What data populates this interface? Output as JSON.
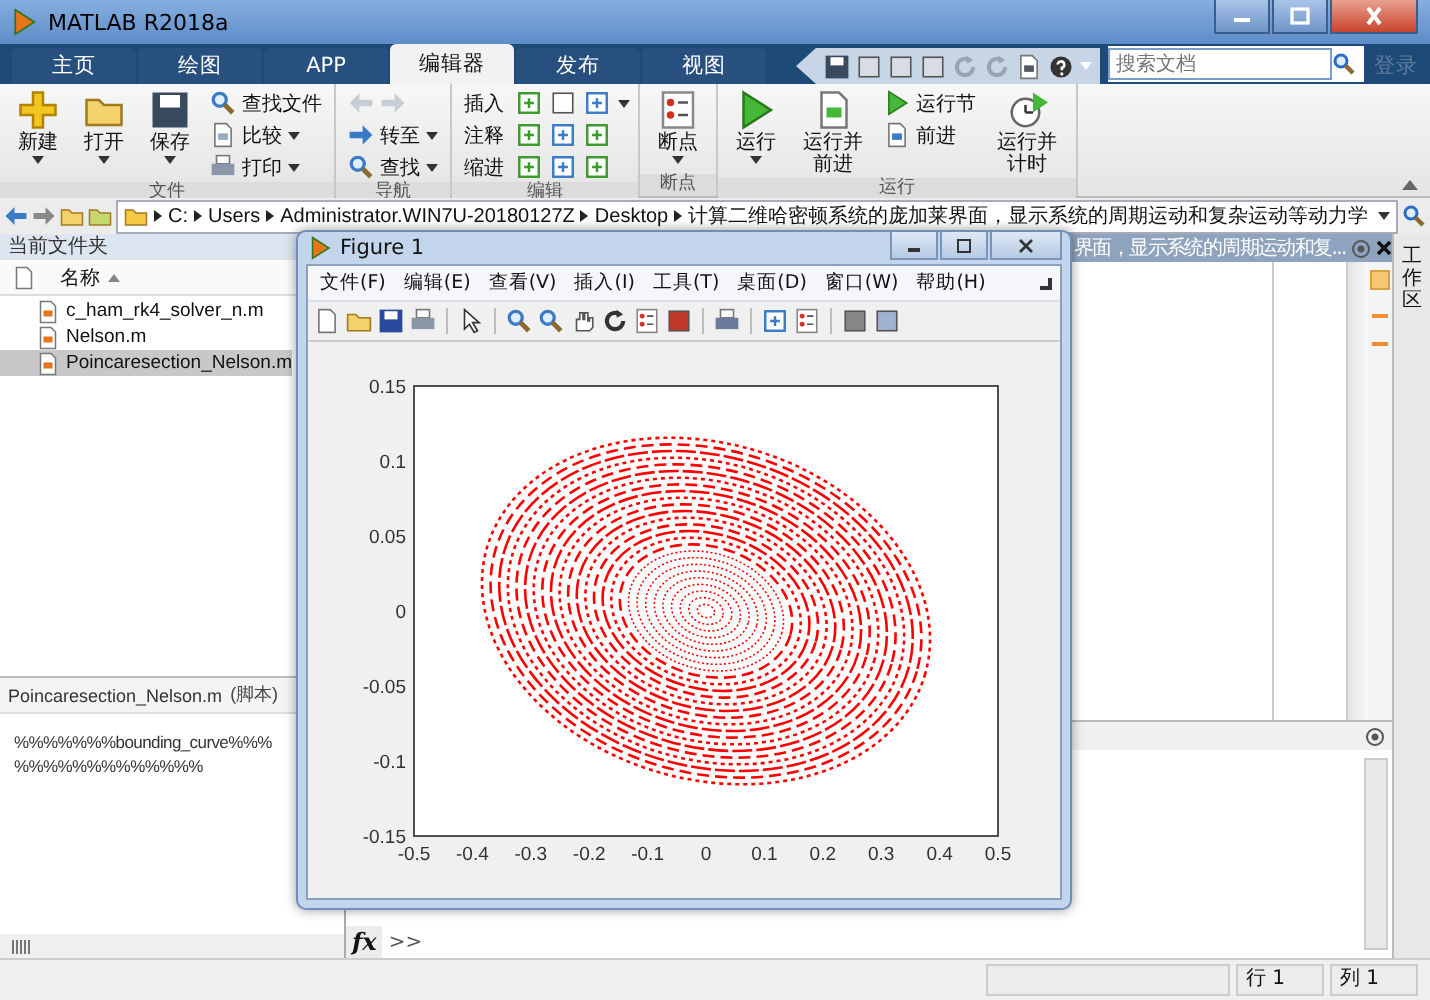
{
  "window": {
    "title": "MATLAB R2018a"
  },
  "tabs": [
    {
      "label": "主页",
      "selected": false
    },
    {
      "label": "绘图",
      "selected": false
    },
    {
      "label": "APP",
      "selected": false
    },
    {
      "label": "编辑器",
      "selected": true
    },
    {
      "label": "发布",
      "selected": false
    },
    {
      "label": "视图",
      "selected": false
    }
  ],
  "search": {
    "placeholder": "搜索文档"
  },
  "sign_in": "登录",
  "ribbon": [
    {
      "title": "文件",
      "columns": [
        [
          {
            "kind": "large",
            "label": "新建",
            "dropdown": true
          }
        ],
        [
          {
            "kind": "large",
            "label": "打开",
            "dropdown": true
          }
        ],
        [
          {
            "kind": "large",
            "label": "保存",
            "dropdown": true
          }
        ],
        [
          {
            "kind": "small",
            "label": "查找文件",
            "dropdown": false
          },
          {
            "kind": "small",
            "label": "比较",
            "dropdown": true
          },
          {
            "kind": "small",
            "label": "打印",
            "dropdown": true
          }
        ]
      ]
    },
    {
      "title": "导航",
      "columns": [
        [
          {
            "kind": "arrows"
          },
          {
            "kind": "small",
            "label": "转至",
            "dropdown": true
          },
          {
            "kind": "small",
            "label": "查找",
            "dropdown": true
          }
        ]
      ]
    },
    {
      "title": "编辑",
      "columns": [
        [
          {
            "kind": "row",
            "label": "插入",
            "dropdown": true
          },
          {
            "kind": "row",
            "label": "注释",
            "dropdown": false
          },
          {
            "kind": "row",
            "label": "缩进",
            "dropdown": false
          }
        ]
      ]
    },
    {
      "title": "断点",
      "columns": [
        [
          {
            "kind": "large",
            "label": "断点",
            "dropdown": true
          }
        ]
      ]
    },
    {
      "title": "运行",
      "columns": [
        [
          {
            "kind": "large",
            "label": "运行",
            "dropdown": true
          }
        ],
        [
          {
            "kind": "large",
            "label": "运行并前进",
            "dropdown": false
          }
        ],
        [
          {
            "kind": "small",
            "label": "运行节",
            "dropdown": false
          },
          {
            "kind": "small",
            "label": "前进",
            "dropdown": false
          }
        ],
        [
          {
            "kind": "large",
            "label": "运行并计时",
            "dropdown": false
          }
        ]
      ]
    }
  ],
  "address": {
    "segments": [
      "C:",
      "Users",
      "Administrator.WIN7U-20180127Z",
      "Desktop",
      "计算二维哈密顿系统的庞加莱界面，显示系统的周期运动和复杂运动等动力学"
    ]
  },
  "current_folder": {
    "title": "当前文件夹",
    "column": "名称",
    "files": [
      {
        "name": "c_ham_rk4_solver_n.m",
        "selected": false
      },
      {
        "name": "Nelson.m",
        "selected": false
      },
      {
        "name": "Poincaresection_Nelson.m",
        "selected": true
      }
    ]
  },
  "details": {
    "title": "Poincaresection_Nelson.m",
    "type": "(脚本)",
    "lines": [
      "%%%%%%%bounding_curve%%%",
      "%%%%%%%%%%%%%"
    ]
  },
  "editor": {
    "tab_title": "界面，显示系统的周期运动和复..."
  },
  "command_window": {
    "fx": "fx",
    "prompt": ">>"
  },
  "workspace_label": "工作区",
  "status_bar": {
    "line": "行 1",
    "column": "列 1"
  },
  "figure": {
    "title": "Figure 1",
    "menu": [
      "文件(F)",
      "编辑(E)",
      "查看(V)",
      "插入(I)",
      "工具(T)",
      "桌面(D)",
      "窗口(W)",
      "帮助(H)"
    ],
    "x_ticks": [
      "-0.5",
      "-0.4",
      "-0.3",
      "-0.2",
      "-0.1",
      "0",
      "0.1",
      "0.2",
      "0.3",
      "0.4",
      "0.5"
    ],
    "y_ticks": [
      "0.15",
      "0.1",
      "0.05",
      "0",
      "-0.05",
      "-0.1",
      "-0.15"
    ]
  }
}
